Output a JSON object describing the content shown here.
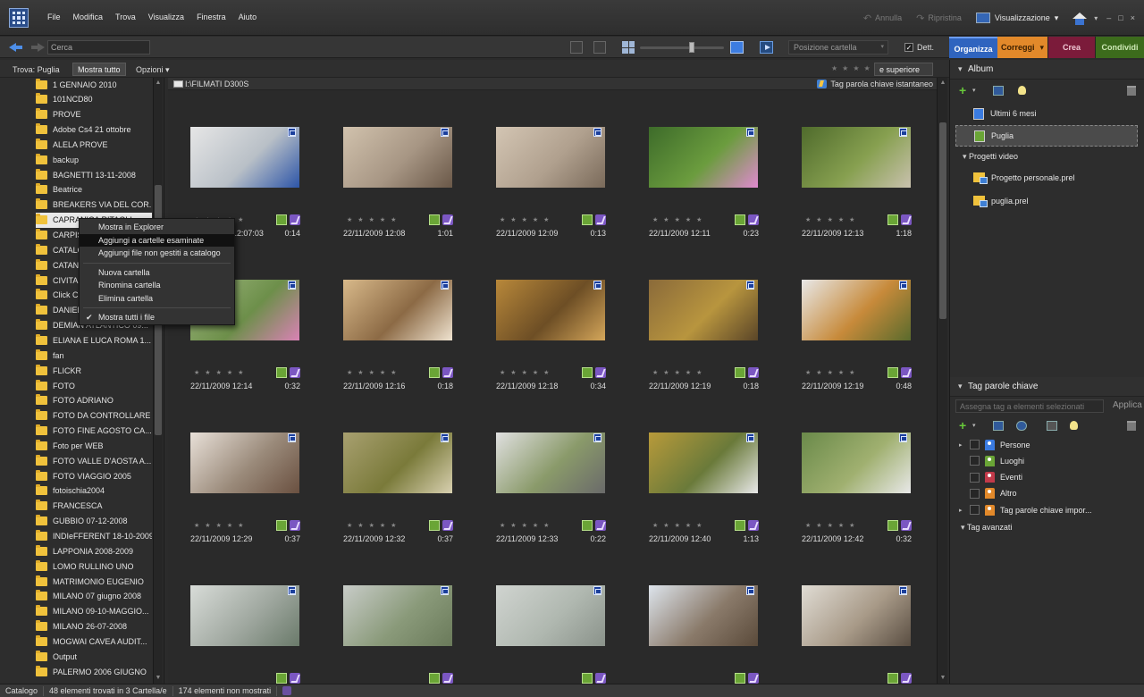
{
  "menu": [
    "File",
    "Modifica",
    "Trova",
    "Visualizza",
    "Finestra",
    "Aiuto"
  ],
  "topbar": {
    "undo_label": "Annulla",
    "redo_label": "Ripristina",
    "view_label": "Visualizzazione",
    "view_caret": "▾",
    "window_buttons": [
      "–",
      "□",
      "×"
    ]
  },
  "toolbar": {
    "search_placeholder": "Cerca",
    "sort_label": "Posizione cartella",
    "details_label": "Dett.",
    "zoom_level": 0.62
  },
  "tabs": {
    "organizza": "Organizza",
    "correggi": "Correggi",
    "crea": "Crea",
    "condividi": "Condividi"
  },
  "findbar": {
    "label": "Trova: Puglia",
    "show_all": "Mostra tutto",
    "options": "Opzioni",
    "rating_compare": "e superiore"
  },
  "folders": [
    "1 GENNAIO 2010",
    "101NCD80",
    "PROVE",
    "Adobe Cs4 21 ottobre",
    "ALELA PROVE",
    "backup",
    "BAGNETTI  13-11-2008",
    "Beatrice",
    "BREAKERS VIA DEL COR...",
    "CAPRANICA RITAGLI",
    "CARPIS",
    "CATALO",
    "CATANI",
    "CIVITA",
    "Click Cu",
    "DANIEL",
    "DEMIAN ATLANTICO 09...",
    "ELIANA E LUCA ROMA 1...",
    "fan",
    "FLICKR",
    "FOTO",
    "FOTO ADRIANO",
    "FOTO DA CONTROLLARE",
    "FOTO FINE AGOSTO CA...",
    "Foto per WEB",
    "FOTO VALLE D'AOSTA A...",
    "FOTO VIAGGIO 2005",
    "fotoischia2004",
    "FRANCESCA",
    "GUBBIO 07-12-2008",
    "INDIeFFERENT 18-10-2009",
    "LAPPONIA 2008-2009",
    "LOMO RULLINO UNO",
    "MATRIMONIO EUGENIO",
    "MILANO 07 giugno 2008",
    "MILANO 09-10-MAGGIO...",
    "MILANO 26-07-2008",
    "MOGWAI CAVEA AUDIT...",
    "Output",
    "PALERMO 2006 GIUGNO"
  ],
  "context_menu": {
    "items": [
      {
        "label": "Mostra in Explorer"
      },
      {
        "label": "Aggiungi a cartelle esaminate"
      },
      {
        "label": "Aggiungi file non gestiti a catalogo"
      },
      {
        "label": "Nuova cartella"
      },
      {
        "label": "Rinomina cartella"
      },
      {
        "label": "Elimina cartella"
      },
      {
        "label": "Mostra tutti i file",
        "check": "✔"
      }
    ]
  },
  "path": {
    "text": "I:\\FILMATI D300S",
    "instant_tag": "Tag parola chiave istantaneo"
  },
  "thumbnails": [
    {
      "date": "22/11/2009 12:07:03",
      "duration": "0:14",
      "colors": [
        "#e6e6e6",
        "#b9c0c7",
        "#2d55a8"
      ]
    },
    {
      "date": "22/11/2009 12:08",
      "duration": "1:01",
      "colors": [
        "#d1c2ad",
        "#a79684",
        "#6a5848"
      ]
    },
    {
      "date": "22/11/2009 12:09",
      "duration": "0:13",
      "colors": [
        "#d3c5b3",
        "#b0a08e",
        "#7a6a5a"
      ]
    },
    {
      "date": "22/11/2009 12:11",
      "duration": "0:23",
      "colors": [
        "#3d6b2a",
        "#6b9c3e",
        "#e08ad0"
      ]
    },
    {
      "date": "22/11/2009 12:13",
      "duration": "1:18",
      "colors": [
        "#4f6b2c",
        "#87a050",
        "#c9c1ae"
      ]
    },
    {
      "date": "22/11/2009 12:14",
      "duration": "0:32",
      "colors": [
        "#9fb880",
        "#6d8f4a",
        "#d982b5"
      ]
    },
    {
      "date": "22/11/2009 12:16",
      "duration": "0:18",
      "colors": [
        "#d8b98a",
        "#8c6a45",
        "#efe3d0"
      ]
    },
    {
      "date": "22/11/2009 12:18",
      "duration": "0:34",
      "colors": [
        "#b8883a",
        "#6d4e25",
        "#d4a65a"
      ]
    },
    {
      "date": "22/11/2009 12:19",
      "duration": "0:18",
      "colors": [
        "#8a6a3a",
        "#b8953e",
        "#5a4528"
      ]
    },
    {
      "date": "22/11/2009 12:19",
      "duration": "0:48",
      "colors": [
        "#e8e8e8",
        "#c78a3a",
        "#5a6b2d"
      ]
    },
    {
      "date": "22/11/2009 12:29",
      "duration": "0:37",
      "colors": [
        "#e8e0d8",
        "#9a8a7a",
        "#6a5040"
      ]
    },
    {
      "date": "22/11/2009 12:32",
      "duration": "0:37",
      "colors": [
        "#a8a070",
        "#7a7a3a",
        "#d8d0b0"
      ]
    },
    {
      "date": "22/11/2009 12:33",
      "duration": "0:22",
      "colors": [
        "#e0e0e0",
        "#8a9a6a",
        "#6a6a6a"
      ]
    },
    {
      "date": "22/11/2009 12:40",
      "duration": "1:13",
      "colors": [
        "#b89a3a",
        "#6a7a3a",
        "#e8e8e8"
      ]
    },
    {
      "date": "22/11/2009 12:42",
      "duration": "0:32",
      "colors": [
        "#6a8a4a",
        "#a0b070",
        "#e8e8e8"
      ]
    },
    {
      "date": "",
      "duration": "",
      "colors": [
        "#d8dcd8",
        "#a0a8a0",
        "#6a7a6a"
      ]
    },
    {
      "date": "",
      "duration": "",
      "colors": [
        "#c8ccc8",
        "#8a9a7a",
        "#6a7a5a"
      ]
    },
    {
      "date": "",
      "duration": "",
      "colors": [
        "#d0d4d0",
        "#b0b8b0",
        "#8a928a"
      ]
    },
    {
      "date": "",
      "duration": "",
      "colors": [
        "#dde4ec",
        "#8a7a6a",
        "#5a4a3a"
      ]
    },
    {
      "date": "",
      "duration": "",
      "colors": [
        "#e0dcd4",
        "#a89a88",
        "#5a4e42"
      ]
    }
  ],
  "albums": {
    "header": "Album",
    "items": [
      {
        "label": "Ultimi 6 mesi",
        "color": "#3a7be0"
      },
      {
        "label": "Puglia",
        "color": "#6aa536"
      }
    ],
    "video_header": "Progetti video",
    "projects": [
      "Progetto personale.prel",
      "puglia.prel"
    ]
  },
  "tags": {
    "header": "Tag parole chiave",
    "search_placeholder": "Assegna tag a elementi selezionati",
    "apply": "Applica",
    "items": [
      {
        "label": "Persone",
        "color": "#3a7be0",
        "expandable": true
      },
      {
        "label": "Luoghi",
        "color": "#6aa536",
        "expandable": false
      },
      {
        "label": "Eventi",
        "color": "#c23a4a",
        "expandable": false
      },
      {
        "label": "Altro",
        "color": "#e2892a",
        "expandable": false
      },
      {
        "label": "Tag parole chiave impor...",
        "color": "#e2892a",
        "expandable": true
      }
    ],
    "advanced": "Tag avanzati"
  },
  "status": {
    "catalog": "Catalogo",
    "found": "48 elementi trovati in 3 Cartella/e",
    "hidden": "174 elementi non mostrati"
  }
}
